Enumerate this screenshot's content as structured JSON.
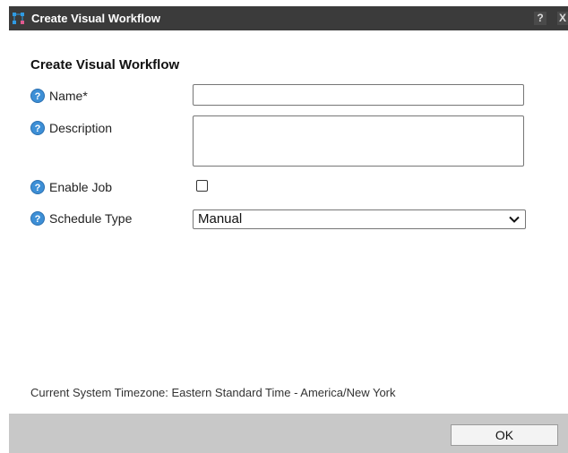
{
  "dialog": {
    "window_title": "Create Visual Workflow",
    "help_label": "?",
    "close_label": "X",
    "heading": "Create Visual Workflow"
  },
  "form": {
    "name": {
      "label": "Name*",
      "value": ""
    },
    "description": {
      "label": "Description",
      "value": ""
    },
    "enable_job": {
      "label": "Enable Job",
      "checked": false
    },
    "schedule_type": {
      "label": "Schedule Type",
      "selected": "Manual"
    }
  },
  "timezone_text": "Current System Timezone: Eastern Standard Time - America/New York",
  "footer": {
    "ok_label": "OK"
  },
  "colors": {
    "titlebar_bg": "#3b3b3b",
    "help_icon_fill": "#3d8fd6",
    "footer_bg": "#c8c8c8"
  },
  "icons": {
    "app": "workflow-icon",
    "field_help": "question-mark-circle-icon",
    "dropdown": "chevron-down-icon"
  }
}
